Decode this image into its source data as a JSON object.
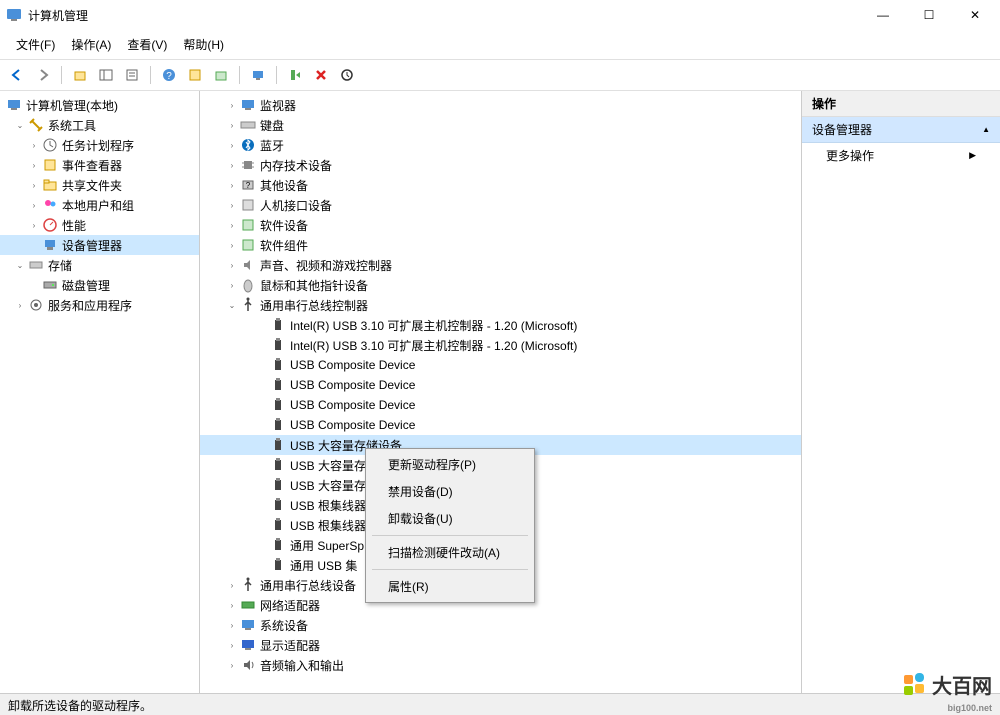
{
  "window": {
    "title": "计算机管理",
    "min": "—",
    "max": "☐",
    "close": "✕"
  },
  "menu": [
    "文件(F)",
    "操作(A)",
    "查看(V)",
    "帮助(H)"
  ],
  "leftTree": {
    "root": "计算机管理(本地)",
    "systemTools": "系统工具",
    "taskScheduler": "任务计划程序",
    "eventViewer": "事件查看器",
    "sharedFolders": "共享文件夹",
    "localUsers": "本地用户和组",
    "performance": "性能",
    "deviceManager": "设备管理器",
    "storage": "存储",
    "diskMgmt": "磁盘管理",
    "services": "服务和应用程序"
  },
  "devices": {
    "monitor": "监视器",
    "keyboard": "键盘",
    "bluetooth": "蓝牙",
    "memory": "内存技术设备",
    "other": "其他设备",
    "hid": "人机接口设备",
    "software": "软件设备",
    "softwareComp": "软件组件",
    "audio": "声音、视频和游戏控制器",
    "mouse": "鼠标和其他指针设备",
    "usbController": "通用串行总线控制器",
    "usbItems": [
      "Intel(R) USB 3.10 可扩展主机控制器 - 1.20 (Microsoft)",
      "Intel(R) USB 3.10 可扩展主机控制器 - 1.20 (Microsoft)",
      "USB Composite Device",
      "USB Composite Device",
      "USB Composite Device",
      "USB Composite Device",
      "USB 大容量存储设备",
      "USB 大容量存",
      "USB 大容量存",
      "USB 根集线器",
      "USB 根集线器",
      "通用 SuperSp",
      "通用 USB 集"
    ],
    "usbDevices2": "通用串行总线设备",
    "network": "网络适配器",
    "system": "系统设备",
    "display": "显示适配器",
    "audioInOut": "音频输入和输出"
  },
  "contextMenu": {
    "update": "更新驱动程序(P)",
    "disable": "禁用设备(D)",
    "uninstall": "卸载设备(U)",
    "scan": "扫描检测硬件改动(A)",
    "properties": "属性(R)"
  },
  "rightPanel": {
    "header": "操作",
    "section": "设备管理器",
    "moreActions": "更多操作"
  },
  "status": "卸载所选设备的驱动程序。",
  "watermark": {
    "main": "大百网",
    "sub": "big100.net"
  }
}
